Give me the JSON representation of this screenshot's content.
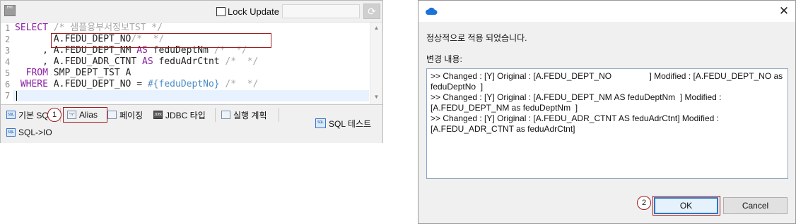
{
  "editor": {
    "toolbar": {
      "format_icon": "SQL format icon",
      "format_icon_text": "FMT",
      "lock_label": "Lock Update",
      "lock_checked": false,
      "lock_value": "",
      "refresh_icon": "refresh-icon"
    },
    "line_numbers": [
      "1",
      "2",
      "3",
      "4",
      "5",
      "6",
      "7"
    ],
    "lines": [
      [
        {
          "t": "SELECT ",
          "c": "kw"
        },
        {
          "t": "/* 샘플용부서정보TST */",
          "c": "cm"
        }
      ],
      [
        {
          "t": "       A.FEDU_DEPT_NO",
          "c": ""
        },
        {
          "t": "/*  */",
          "c": "cm"
        }
      ],
      [
        {
          "t": "     , A.FEDU_DEPT_NM ",
          "c": ""
        },
        {
          "t": "AS",
          "c": "kw"
        },
        {
          "t": " feduDeptNm ",
          "c": ""
        },
        {
          "t": "/*  */",
          "c": "cm"
        }
      ],
      [
        {
          "t": "     , A.FEDU_ADR_CTNT ",
          "c": ""
        },
        {
          "t": "AS",
          "c": "kw"
        },
        {
          "t": " feduAdrCtnt ",
          "c": ""
        },
        {
          "t": "/*  */",
          "c": "cm"
        }
      ],
      [
        {
          "t": "  ",
          "c": ""
        },
        {
          "t": "FROM",
          "c": "kw"
        },
        {
          "t": " SMP_DEPT_TST A",
          "c": ""
        }
      ],
      [
        {
          "t": " ",
          "c": ""
        },
        {
          "t": "WHERE",
          "c": "kw"
        },
        {
          "t": " A.FEDU_DEPT_NO = ",
          "c": ""
        },
        {
          "t": "#{feduDeptNo}",
          "c": "pl"
        },
        {
          "t": " /*  */",
          "c": "cm"
        }
      ],
      [
        {
          "t": "",
          "c": ""
        }
      ]
    ],
    "bottom_toolbar": {
      "basic_sql_label": "기본 SQ",
      "basic_sql_icon_text": "SQL",
      "alias_label": "Alias",
      "alias_icon_text": "\"n\"",
      "paging_label": "페이징",
      "jdbc_label": "JDBC 타입",
      "jdbc_icon_text": "JDBC",
      "plan_label": "실행 계획",
      "sql_test_label": "SQL 테스트",
      "sql_test_icon_text": "SQL",
      "sql_io_label": "SQL->IO",
      "sql_io_icon_text": "SQL"
    },
    "step_marker_1": "1"
  },
  "dialog": {
    "message": "정상적으로 적용 되었습니다.",
    "changes_label": "변경 내용:",
    "changes_text": ">> Changed : [Y] Original : [A.FEDU_DEPT_NO                ] Modified : [A.FEDU_DEPT_NO as feduDeptNo  ]\n>> Changed : [Y] Original : [A.FEDU_DEPT_NM AS feduDeptNm  ] Modified : [A.FEDU_DEPT_NM as feduDeptNm  ]\n>> Changed : [Y] Original : [A.FEDU_ADR_CTNT AS feduAdrCtnt] Modified : [A.FEDU_ADR_CTNT as feduAdrCtnt]",
    "ok_label": "OK",
    "cancel_label": "Cancel",
    "close_glyph": "✕",
    "step_marker_2": "2"
  },
  "colors": {
    "keyword": "#8a1fa3",
    "comment": "#a8a8a8",
    "placeholder": "#4b8dc7",
    "annotation_red": "#a11d1d",
    "focus_blue": "#2e77c9"
  }
}
